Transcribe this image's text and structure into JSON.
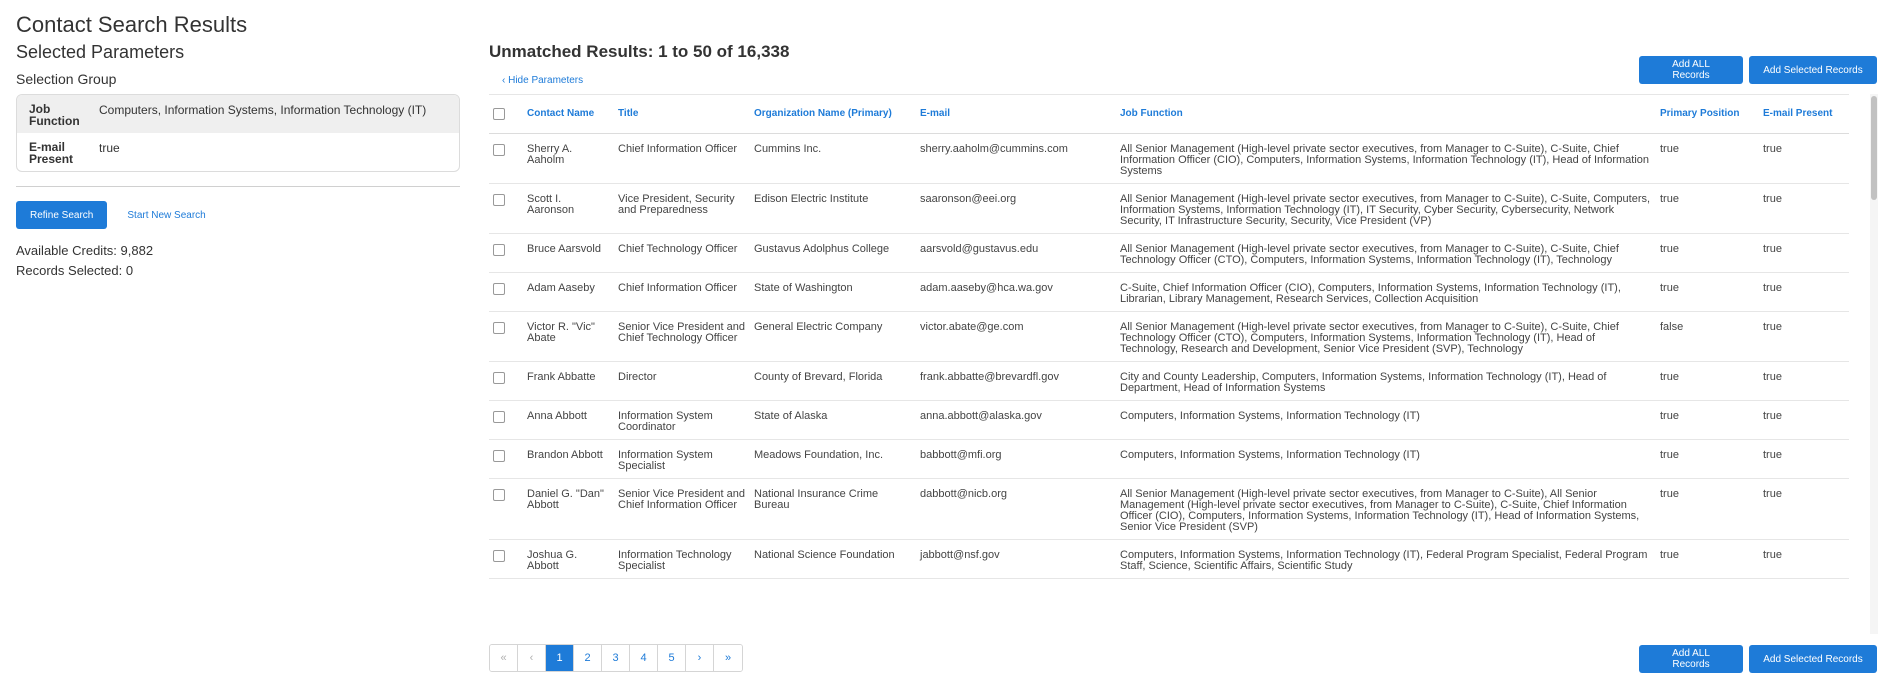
{
  "page": {
    "title": "Contact Search Results"
  },
  "left": {
    "selected_parameters_label": "Selected Parameters",
    "selection_group_label": "Selection Group",
    "parameters": [
      {
        "key": "Job Function",
        "value": "Computers, Information Systems, Information Technology (IT)"
      },
      {
        "key": "E-mail Present",
        "value": "true"
      }
    ],
    "refine_button": "Refine Search",
    "new_search_link": "Start New Search",
    "available_credits": "Available Credits: 9,882",
    "records_selected": "Records Selected: 0"
  },
  "results": {
    "heading": "Unmatched Results: 1 to 50 of 16,338",
    "hide_parameters": "‹ Hide Parameters",
    "add_all_label": "Add ALL Records",
    "add_selected_label": "Add Selected Records",
    "columns": [
      "Contact Name",
      "Title",
      "Organization Name (Primary)",
      "E-mail",
      "Job Function",
      "Primary Position",
      "E-mail Present"
    ],
    "rows": [
      {
        "name": "Sherry A. Aaholm",
        "title": "Chief Information Officer",
        "org": "Cummins Inc.",
        "email": "sherry.aaholm@cummins.com",
        "job_function": "All Senior Management (High-level private sector executives, from Manager to C-Suite), C-Suite, Chief Information Officer (CIO), Computers, Information Systems, Information Technology (IT), Head of Information Systems",
        "primary": "true",
        "email_present": "true"
      },
      {
        "name": "Scott I. Aaronson",
        "title": "Vice President, Security and Preparedness",
        "org": "Edison Electric Institute",
        "email": "saaronson@eei.org",
        "job_function": "All Senior Management (High-level private sector executives, from Manager to C-Suite), C-Suite, Computers, Information Systems, Information Technology (IT), IT Security, Cyber Security, Cybersecurity, Network Security, IT Infrastructure Security, Security, Vice President (VP)",
        "primary": "true",
        "email_present": "true"
      },
      {
        "name": "Bruce Aarsvold",
        "title": "Chief Technology Officer",
        "org": "Gustavus Adolphus College",
        "email": "aarsvold@gustavus.edu",
        "job_function": "All Senior Management (High-level private sector executives, from Manager to C-Suite), C-Suite, Chief Technology Officer (CTO), Computers, Information Systems, Information Technology (IT), Technology",
        "primary": "true",
        "email_present": "true"
      },
      {
        "name": "Adam Aaseby",
        "title": "Chief Information Officer",
        "org": "State of Washington",
        "email": "adam.aaseby@hca.wa.gov",
        "job_function": "C-Suite, Chief Information Officer (CIO), Computers, Information Systems, Information Technology (IT), Librarian, Library Management, Research Services, Collection Acquisition",
        "primary": "true",
        "email_present": "true"
      },
      {
        "name": "Victor R. \"Vic\" Abate",
        "title": "Senior Vice President and Chief Technology Officer",
        "org": "General Electric Company",
        "email": "victor.abate@ge.com",
        "job_function": "All Senior Management (High-level private sector executives, from Manager to C-Suite), C-Suite, Chief Technology Officer (CTO), Computers, Information Systems, Information Technology (IT), Head of Technology, Research and Development, Senior Vice President (SVP), Technology",
        "primary": "false",
        "email_present": "true"
      },
      {
        "name": "Frank Abbatte",
        "title": "Director",
        "org": "County of Brevard, Florida",
        "email": "frank.abbatte@brevardfl.gov",
        "job_function": "City and County Leadership, Computers, Information Systems, Information Technology (IT), Head of Department, Head of Information Systems",
        "primary": "true",
        "email_present": "true"
      },
      {
        "name": "Anna Abbott",
        "title": "Information System Coordinator",
        "org": "State of Alaska",
        "email": "anna.abbott@alaska.gov",
        "job_function": "Computers, Information Systems, Information Technology (IT)",
        "primary": "true",
        "email_present": "true"
      },
      {
        "name": "Brandon Abbott",
        "title": "Information System Specialist",
        "org": "Meadows Foundation, Inc.",
        "email": "babbott@mfi.org",
        "job_function": "Computers, Information Systems, Information Technology (IT)",
        "primary": "true",
        "email_present": "true"
      },
      {
        "name": "Daniel G. \"Dan\" Abbott",
        "title": "Senior Vice President and Chief Information Officer",
        "org": "National Insurance Crime Bureau",
        "email": "dabbott@nicb.org",
        "job_function": "All Senior Management (High-level private sector executives, from Manager to C-Suite), All Senior Management (High-level private sector executives, from Manager to C-Suite), C-Suite, Chief Information Officer (CIO), Computers, Information Systems, Information Technology (IT), Head of Information Systems, Senior Vice President (SVP)",
        "primary": "true",
        "email_present": "true"
      },
      {
        "name": "Joshua G. Abbott",
        "title": "Information Technology Specialist",
        "org": "National Science Foundation",
        "email": "jabbott@nsf.gov",
        "job_function": "Computers, Information Systems, Information Technology (IT), Federal Program Specialist, Federal Program Staff, Science, Scientific Affairs, Scientific Study",
        "primary": "true",
        "email_present": "true"
      }
    ]
  },
  "pagination": {
    "first": "«",
    "prev": "‹",
    "pages": [
      "1",
      "2",
      "3",
      "4",
      "5"
    ],
    "current": "1",
    "next": "›",
    "last": "»"
  }
}
